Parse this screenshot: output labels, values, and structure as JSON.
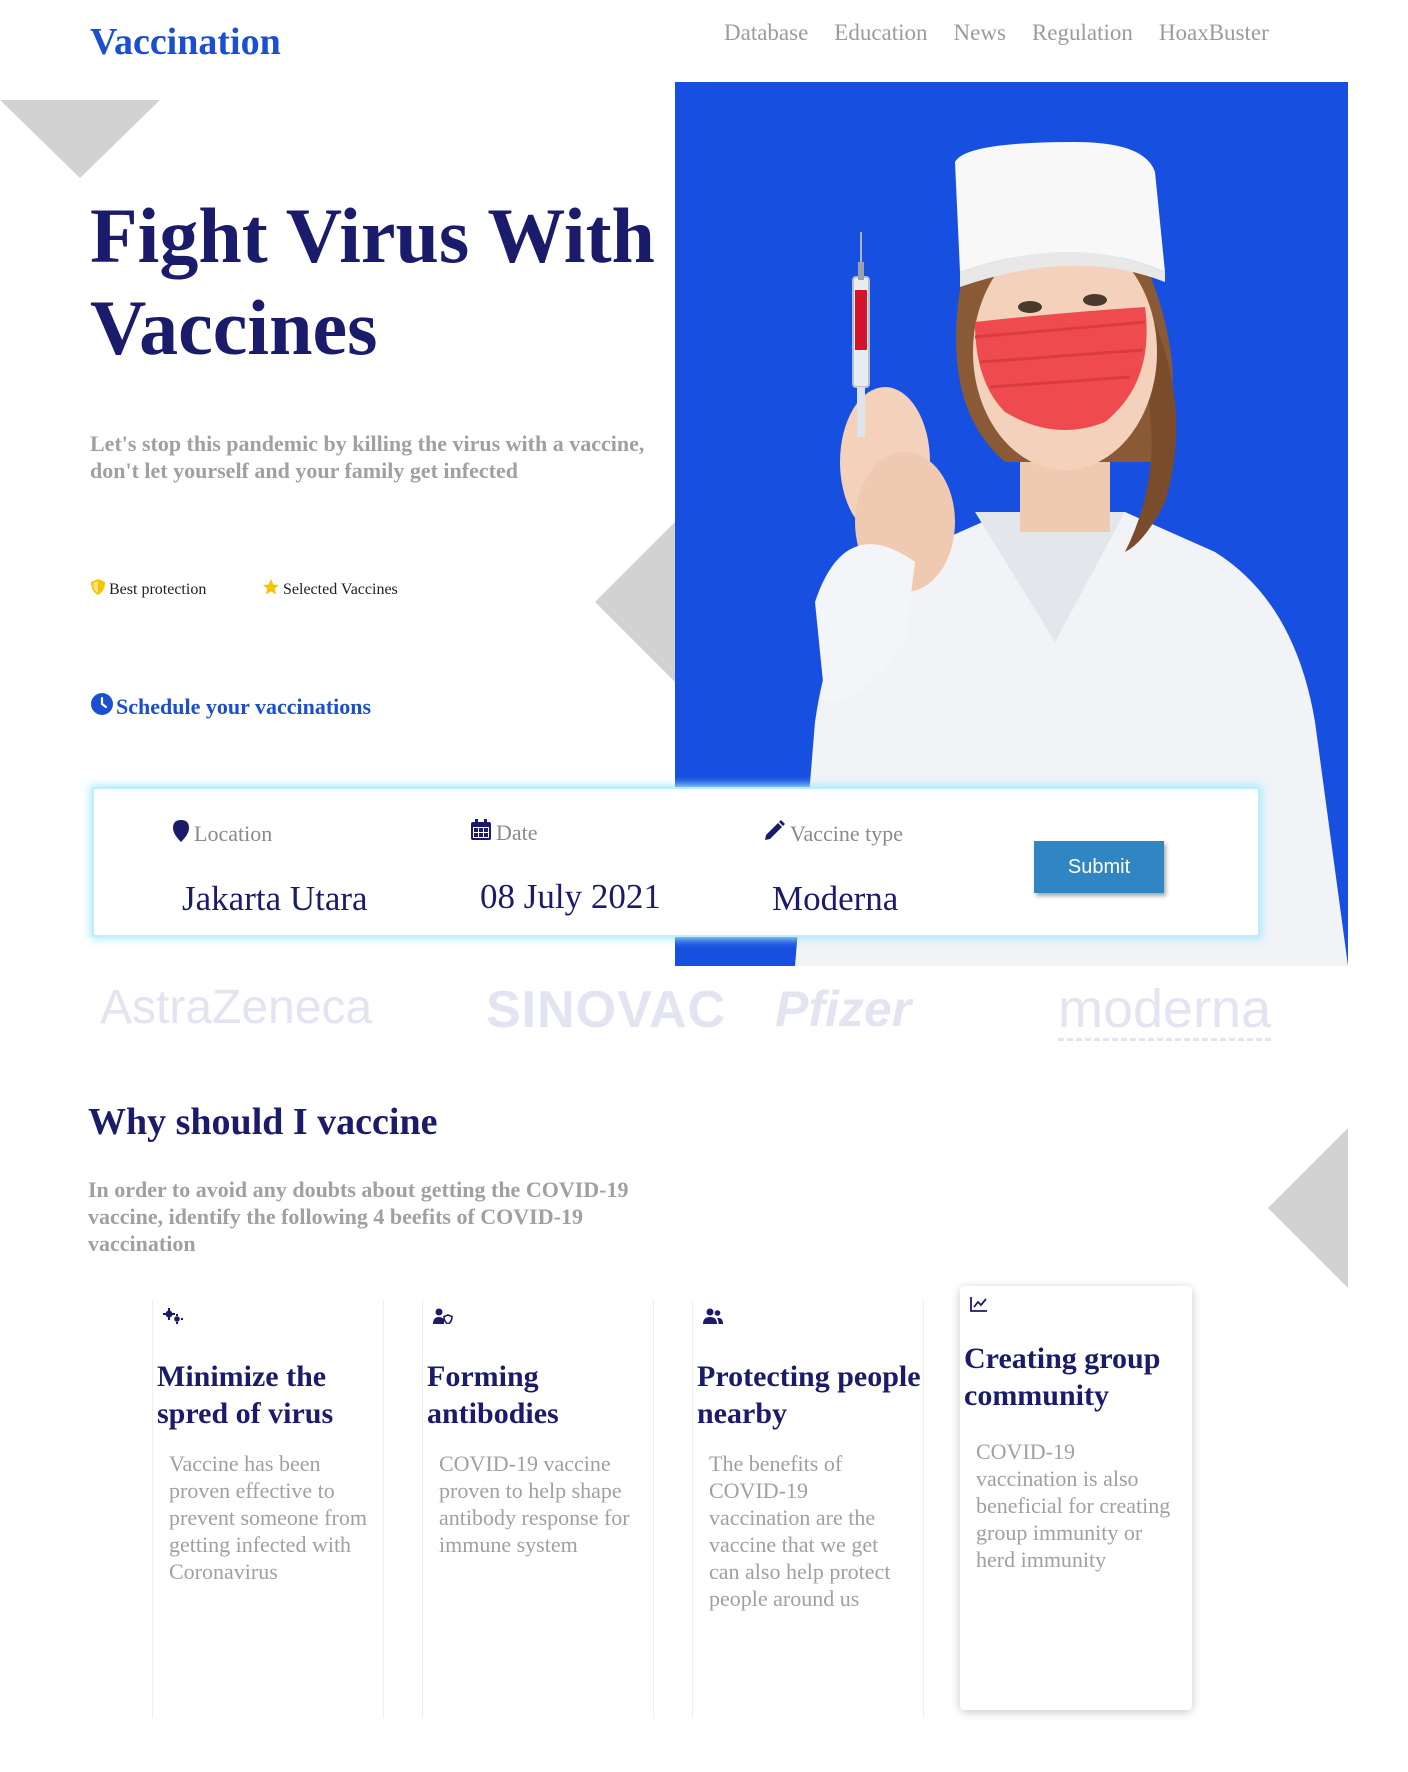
{
  "brand": "Vaccination",
  "nav": [
    "Database",
    "Education",
    "News",
    "Regulation",
    "HoaxBuster"
  ],
  "hero": {
    "title": "Fight Virus With Vaccines",
    "subtitle": "Let's stop this pandemic by killing the virus with a vaccine, don't let yourself and your family get infected",
    "features": [
      "Best protection",
      "Selected Vaccines"
    ],
    "schedule_label": "Schedule your vaccinations"
  },
  "booking": {
    "location_label": "Location",
    "location_value": "Jakarta Utara",
    "date_label": "Date",
    "date_value": "08 July 2021",
    "vaccine_label": "Vaccine type",
    "vaccine_value": "Moderna",
    "submit_label": "Submit"
  },
  "brands": [
    "AstraZeneca",
    "SINOVAC",
    "Pfizer",
    "moderna"
  ],
  "why": {
    "title": "Why should I vaccine",
    "subtitle": "In order to avoid any doubts about getting the COVID-19 vaccine, identify the following 4 beefits of COVID-19 vaccination"
  },
  "benefits": [
    {
      "icon": "virus-icon",
      "title": "Minimize the spred of virus",
      "text": "Vaccine has been proven effective to prevent someone from getting infected with Coronavirus"
    },
    {
      "icon": "user-shield-icon",
      "title": "Forming antibodies",
      "text": "COVID-19 vaccine proven to help shape antibody response for immune system"
    },
    {
      "icon": "users-icon",
      "title": "Protecting people nearby",
      "text": "The benefits of COVID-19 vaccination are the vaccine that we get can also help protect people around us"
    },
    {
      "icon": "chart-line-icon",
      "title": "Creating group community",
      "text": "COVID-19 vaccination is also beneficial for creating group immunity or herd immunity"
    }
  ],
  "colors": {
    "primary": "#1a4fd1",
    "navy": "#1b1b6b",
    "hero_bg": "#1750e0",
    "submit": "#2f86c2"
  }
}
